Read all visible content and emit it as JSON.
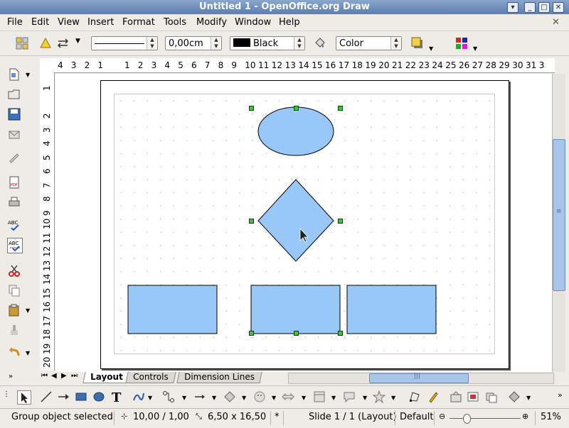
{
  "window": {
    "title": "Untitled 1 - OpenOffice.org Draw"
  },
  "menu": [
    "File",
    "Edit",
    "View",
    "Insert",
    "Format",
    "Tools",
    "Modify",
    "Window",
    "Help"
  ],
  "linebar": {
    "line_width": "0,00cm",
    "line_color": "Black",
    "area_style": "Color"
  },
  "ruler_h": [
    "4",
    "3",
    "2",
    "1",
    "",
    "1",
    "2",
    "3",
    "4",
    "5",
    "6",
    "7",
    "8",
    "9",
    "10",
    "11",
    "12",
    "13",
    "14",
    "15",
    "16",
    "17",
    "18",
    "19",
    "20",
    "21",
    "22",
    "23",
    "24",
    "25",
    "26",
    "27",
    "28",
    "29",
    "30",
    "31",
    "3"
  ],
  "ruler_v": [
    "1",
    "",
    "2",
    "3",
    "4",
    "5",
    "6",
    "7",
    "8",
    "9",
    "10",
    "11",
    "12",
    "13",
    "14",
    "15",
    "16",
    "17",
    "18",
    "19",
    "20"
  ],
  "tabs": [
    "Layout",
    "Controls",
    "Dimension Lines"
  ],
  "status": {
    "selection": "Group object selected",
    "position": "10,00 / 1,00",
    "size": "6,50 x 16,50",
    "modified": "*",
    "slide": "Slide 1 / 1 (Layout)",
    "layout": "Default",
    "zoom": "51%"
  },
  "colors": {
    "shape_fill": "#99c8f8",
    "handle": "#33cc33",
    "titlebar": "#6c8dbf"
  }
}
